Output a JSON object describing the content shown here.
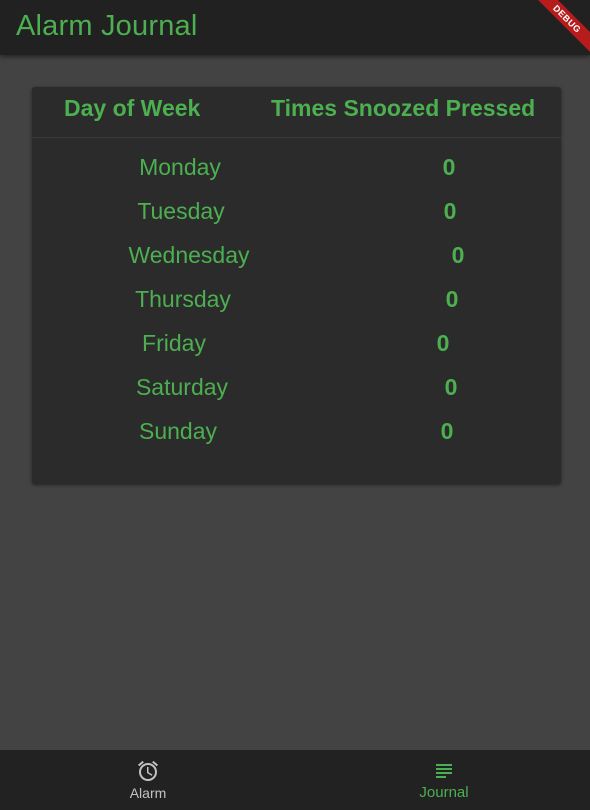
{
  "appbar": {
    "title": "Alarm Journal",
    "debug_label": "DEBUG"
  },
  "table": {
    "headers": {
      "day": "Day of Week",
      "count": "Times Snoozed Pressed"
    },
    "rows": [
      {
        "day": "Monday",
        "count": "0"
      },
      {
        "day": "Tuesday",
        "count": "0"
      },
      {
        "day": "Wednesday",
        "count": "0"
      },
      {
        "day": "Thursday",
        "count": "0"
      },
      {
        "day": "Friday",
        "count": "0"
      },
      {
        "day": "Saturday",
        "count": "0"
      },
      {
        "day": "Sunday",
        "count": "0"
      }
    ]
  },
  "bottom_nav": {
    "items": [
      {
        "label": "Alarm",
        "icon": "alarm-clock-icon",
        "selected": false
      },
      {
        "label": "Journal",
        "icon": "notes-lines-icon",
        "selected": true
      }
    ]
  },
  "colors": {
    "accent": "#4caf50",
    "appbar": "#212121",
    "background": "#434343",
    "card": "#2b2b2b",
    "nav_bar": "#222222",
    "inactive": "#c2c2c2",
    "debug_banner": "#b71c1c"
  }
}
